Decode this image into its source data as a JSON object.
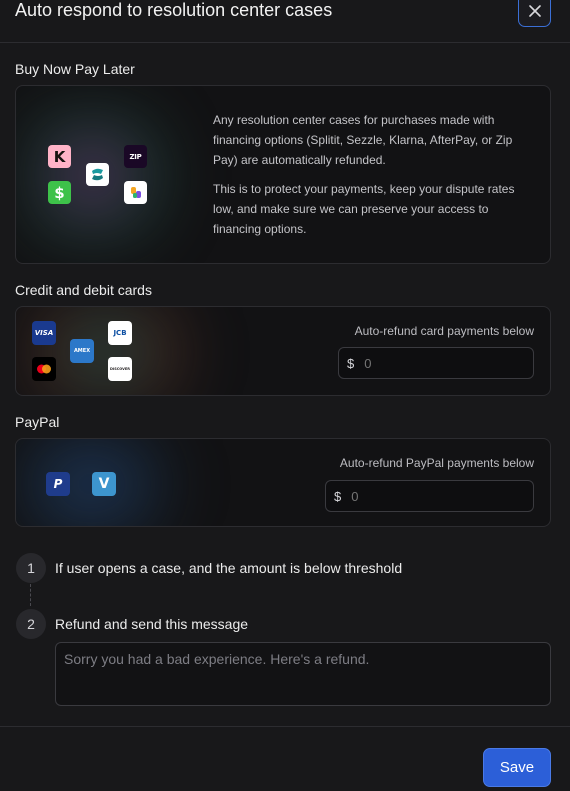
{
  "header": {
    "title": "Auto respond to resolution center cases",
    "close_icon": "close-icon"
  },
  "bnpl": {
    "label": "Buy Now Pay Later",
    "paragraph1": "Any resolution center cases for purchases made with financing options (Splitit, Sezzle, Klarna, AfterPay, or Zip Pay) are automatically refunded.",
    "paragraph2": "This is to protect your payments, keep your dispute rates low, and make sure we can preserve your access to financing options.",
    "logos": {
      "klarna": {
        "glyph": "K",
        "bg": "#ffb3c7",
        "fg": "#17120f"
      },
      "zip": {
        "glyph": "ZIP",
        "bg": "#1a0826",
        "fg": "#ffffff"
      },
      "cash": {
        "glyph": "$",
        "bg": "#3ec24a",
        "fg": "#ffffff"
      },
      "sezzle": {
        "glyph": "",
        "bg": "#ffffff",
        "fg": "#1b9aa0"
      },
      "splitit": {
        "glyph": "",
        "bg": "#ffffff",
        "fg": "#1a1a1a"
      }
    }
  },
  "cards": {
    "label": "Credit and debit cards",
    "field_label": "Auto-refund card payments below",
    "currency": "$",
    "placeholder": "0",
    "logos": {
      "visa": {
        "glyph": "VISA",
        "bg": "#1a3a8f",
        "fg": "#ffffff"
      },
      "amex": {
        "glyph": "AMEX",
        "bg": "#2c78c9",
        "fg": "#ffffff"
      },
      "jcb": {
        "glyph": "JCB",
        "bg": "#ffffff",
        "fg": "#0b4ea2"
      },
      "mastercard": {
        "glyph": "",
        "bg": "#000000",
        "fg": "#eb001b"
      },
      "discover": {
        "glyph": "DISCOVER",
        "bg": "#ffffff",
        "fg": "#231f20"
      }
    }
  },
  "paypal": {
    "label": "PayPal",
    "field_label": "Auto-refund PayPal payments below",
    "currency": "$",
    "placeholder": "0",
    "logos": {
      "paypal": {
        "glyph": "P",
        "bg": "#1f3c8c",
        "fg": "#ffffff"
      },
      "venmo": {
        "glyph": "V",
        "bg": "#3d95ce",
        "fg": "#ffffff"
      }
    }
  },
  "steps": [
    {
      "number": "1",
      "text": "If user opens a case, and the amount is below threshold"
    },
    {
      "number": "2",
      "text": "Refund and send this message"
    }
  ],
  "message": {
    "placeholder": "Sorry you had a bad experience. Here's a refund."
  },
  "footer": {
    "save_label": "Save",
    "accent": "#2c5fd8"
  }
}
